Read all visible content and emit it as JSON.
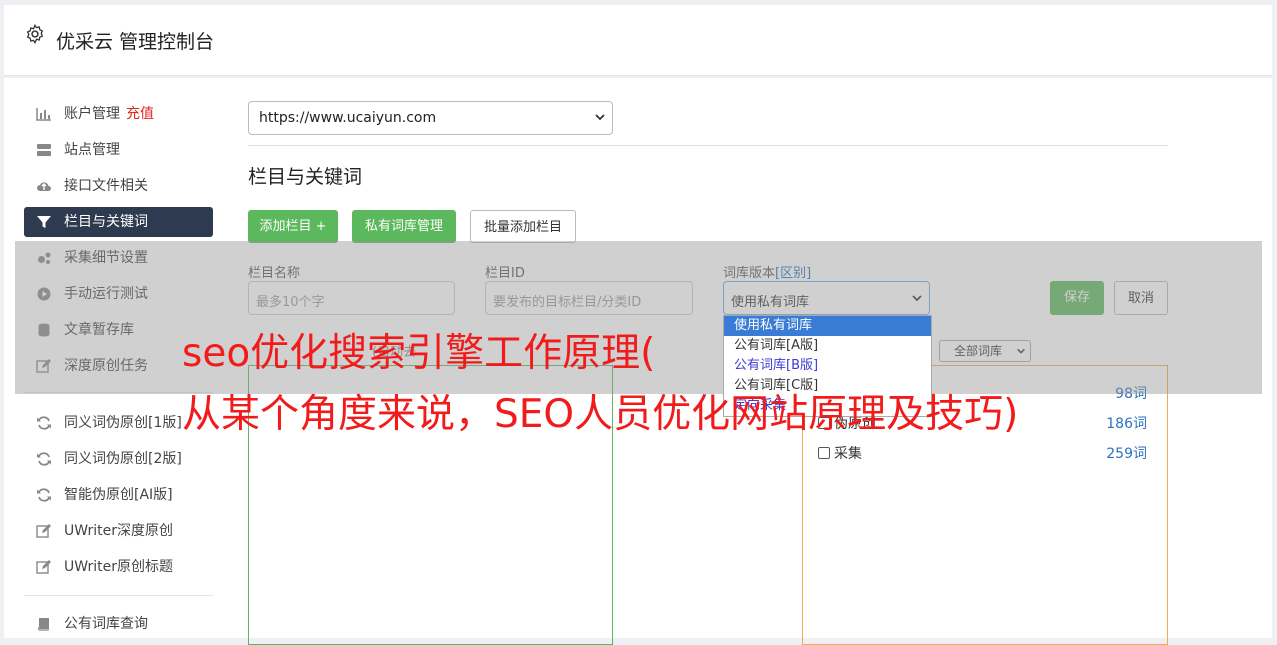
{
  "header": {
    "title": "优采云 管理控制台",
    "icon": "gear-icon"
  },
  "sidebar": {
    "items": [
      {
        "label": "账户管理",
        "extra": "充值",
        "icon": "bar-chart-icon"
      },
      {
        "label": "站点管理",
        "icon": "server-icon"
      },
      {
        "label": "接口文件相关",
        "icon": "cloud-upload-icon"
      },
      {
        "label": "栏目与关键词",
        "icon": "filter-icon",
        "active": true
      },
      {
        "label": "采集细节设置",
        "icon": "cogs-icon"
      },
      {
        "label": "手动运行测试",
        "icon": "play-icon"
      },
      {
        "label": "文章暂存库",
        "icon": "database-icon"
      },
      {
        "label": "深度原创任务",
        "icon": "edit-icon"
      },
      {
        "label": "同义词伪原创[1版]",
        "icon": "refresh-icon"
      },
      {
        "label": "同义词伪原创[2版]",
        "icon": "refresh-icon"
      },
      {
        "label": "智能伪原创[AI版]",
        "icon": "refresh-icon"
      },
      {
        "label": "UWriter深度原创",
        "icon": "edit-icon"
      },
      {
        "label": "UWriter原创标题",
        "icon": "edit-icon"
      },
      {
        "label": "公有词库查询",
        "icon": "book-icon"
      }
    ]
  },
  "main": {
    "site_select": "https://www.ucaiyun.com",
    "section_title": "栏目与关键词",
    "buttons": {
      "add_column": "添加栏目 +",
      "private_lib": "私有词库管理",
      "batch_add": "批量添加栏目"
    },
    "form": {
      "name_label": "栏目名称",
      "name_placeholder": "最多10个字",
      "id_label": "栏目ID",
      "id_placeholder": "要发布的目标栏目/分类ID",
      "lib_label": "词库版本",
      "lib_label_link": "[区别]",
      "lib_value": "使用私有词库",
      "save": "保存",
      "cancel": "取消"
    },
    "lib_options": [
      "使用私有词库",
      "公有词库[A版]",
      "公有词库[B版]",
      "公有词库[C版]",
      "定向采集"
    ],
    "left_link": "(自动去",
    "filter_select": "全部词库",
    "word_libs": [
      {
        "label": "",
        "count": "98词"
      },
      {
        "label": "伪原创",
        "count": "186词"
      },
      {
        "label": "采集",
        "count": "259词"
      }
    ]
  },
  "watermark": {
    "line1": "seo优化搜索引擎工作原理(",
    "line2": "从某个角度来说，SEO人员优化网站原理及技巧)"
  }
}
